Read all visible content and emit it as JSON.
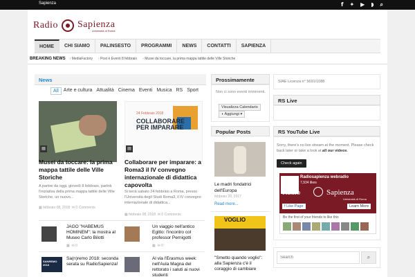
{
  "topbar": {
    "site_link": "Sapienza",
    "social": [
      "f",
      "t",
      "yt",
      "rss",
      "search"
    ]
  },
  "logo": {
    "part1": "Radio",
    "part2": "Sapienza",
    "sub": "Università di Roma"
  },
  "nav": [
    "HOME",
    "CHI SIAMO",
    "PALINSESTO",
    "PROGRAMMI",
    "NEWS",
    "CONTATTI",
    "SAPIENZA"
  ],
  "breaking": {
    "label": "BREAKING NEWS",
    "items": [
      "MediaFactory",
      "Post è Eventi 8 febbraio",
      "Musei da toccare, la prima mappa tattile delle Ville Storiche"
    ]
  },
  "news": {
    "title": "News",
    "categories": [
      "All",
      "Arte e cultura",
      "Attualità",
      "Cinema",
      "Eventi",
      "Musica",
      "RS",
      "Sport"
    ],
    "featured": [
      {
        "title": "Musei da toccare: la prima mappa tattile delle Ville Storiche",
        "text": "A partire da oggi, giovedì 8 febbraio, partirà l'iniziativa della prima mappa tattile delle Ville Storiche, un nuovo...",
        "date": "febbraio 08, 2018",
        "comments": "0 Comments"
      },
      {
        "title": "Collaborare per imparare: a Roma3 il IV convegno internazionale di didattica capovolta",
        "text": "Si terrà sabato 24 febbraio a Roma, presso l'Università degli Studi Roma3, il IV convegno internazionale di didattica...",
        "date": "febbraio 08, 2018",
        "comments": "0 Comments"
      }
    ],
    "featured_image2": {
      "date": "24 Febbraio 2018",
      "banner_1": "COLLABORARE",
      "banner_2": "PER IMPARARE"
    },
    "small": [
      {
        "title": "JAGO \"HABEMUS HOMINEM\": la mostra al Museo Carlo Bilotti",
        "meta": "0"
      },
      {
        "title": "Un viaggio nell'antico Egitto: l'incontro col professor Pernigotti",
        "meta": "0"
      },
      {
        "title": "Sa(n)remo 2018: seconda serata su RadioSapienza!",
        "meta": ""
      },
      {
        "title": "Al via l'Erasmus week: nell'Aula Magna del rettorato i saluti ai nuovi studenti",
        "meta": ""
      }
    ],
    "small_thumb_text": "SANREMO 2018"
  },
  "prossimamente": {
    "title": "Prossimamente",
    "text": "Non ci sono eventi imminenti.",
    "calendar_btn": "Visualizza Calendario",
    "add_btn": "Aggiungi"
  },
  "popular": {
    "title": "Popular Posts",
    "post1_title": "Le madri fondatrici dell'Europa",
    "post1_date": "febbraio 20, 2017",
    "read_more": "Read more...",
    "post2_banner": "VOGLIO",
    "post2_title": "\"Smetto quando voglio\": alla Sapienza c'è il coraggio di cambiare"
  },
  "license": "SIAE Licenza n° 5691/1088",
  "rs_live": {
    "title": "RS Live"
  },
  "yt_live": {
    "title": "RS YouTube Live",
    "text_1": "Sorry, there's no live stream at the moment.",
    "text_2": "Please check back later or take a look at",
    "text_link": "all our videos",
    "button": "Check again"
  },
  "fb": {
    "page_name": "Radiosapienza webradio",
    "likes": "7,934 likes",
    "like_btn": "Like Page",
    "learn_btn": "Learn More",
    "friends_text": "Be the first of your friends to like this",
    "logo_1": "Radio",
    "logo_2": "Sapienza",
    "logo_sub": "Università di Roma"
  },
  "search": {
    "placeholder": "Search"
  }
}
